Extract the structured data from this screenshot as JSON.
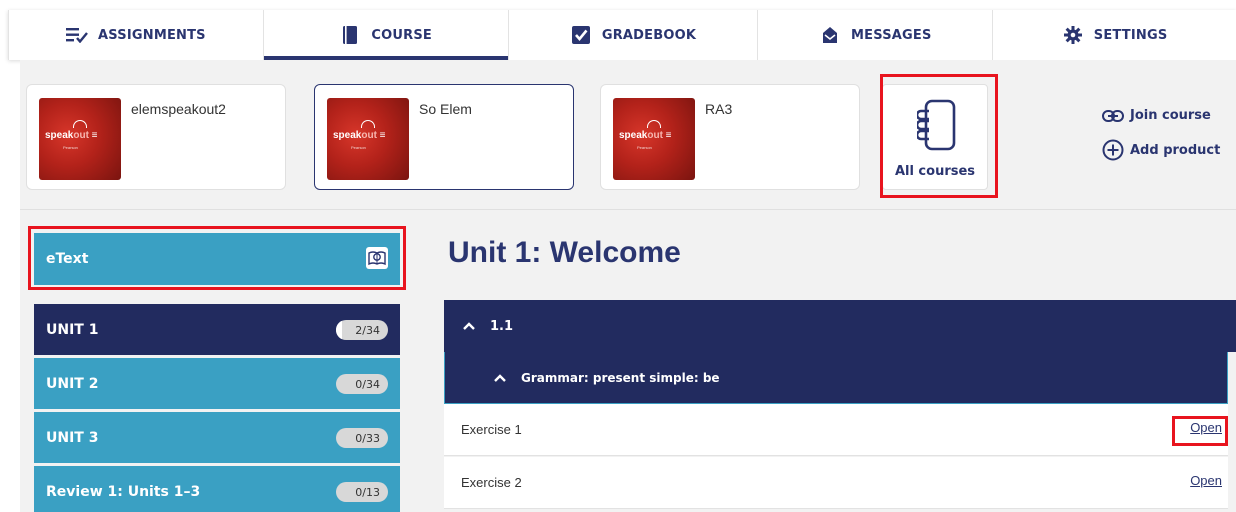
{
  "nav": {
    "tabs": [
      {
        "label": "ASSIGNMENTS",
        "icon": "assignments-icon"
      },
      {
        "label": "COURSE",
        "icon": "book-icon",
        "active": true
      },
      {
        "label": "GRADEBOOK",
        "icon": "gradebook-check-icon"
      },
      {
        "label": "MESSAGES",
        "icon": "envelope-icon"
      },
      {
        "label": "SETTINGS",
        "icon": "gear-icon"
      }
    ]
  },
  "courses": [
    {
      "name": "elemspeakout2",
      "thumb_brand": "speakout",
      "thumb_sub": "Pearson"
    },
    {
      "name": "So Elem",
      "thumb_brand": "speakout",
      "thumb_sub": "Pearson",
      "selected": true
    },
    {
      "name": "RA3",
      "thumb_brand": "speakout",
      "thumb_sub": "Pearson"
    }
  ],
  "all_courses": {
    "label": "All courses",
    "icon": "notebook-icon"
  },
  "actions": {
    "join_course": "Join course",
    "add_product": "Add product"
  },
  "sidebar": {
    "etext_label": "eText",
    "units": [
      {
        "label": "UNIT 1",
        "badge": "2/34",
        "progress": 0.06,
        "style": "dark"
      },
      {
        "label": "UNIT 2",
        "badge": "0/34",
        "progress": 0,
        "style": "light"
      },
      {
        "label": "UNIT 3",
        "badge": "0/33",
        "progress": 0,
        "style": "light"
      },
      {
        "label": "Review 1: Units 1–3",
        "badge": "0/13",
        "progress": 0,
        "style": "light"
      }
    ]
  },
  "content": {
    "title": "Unit 1: Welcome",
    "section": "1.1",
    "subsection": "Grammar: present simple: be",
    "exercises": [
      {
        "label": "Exercise 1",
        "action": "Open"
      },
      {
        "label": "Exercise 2",
        "action": "Open"
      }
    ]
  },
  "colors": {
    "navy": "#222b5f",
    "teal": "#3aa0c3",
    "highlight_red": "#e8141e",
    "brand_text": "#2a3570"
  }
}
